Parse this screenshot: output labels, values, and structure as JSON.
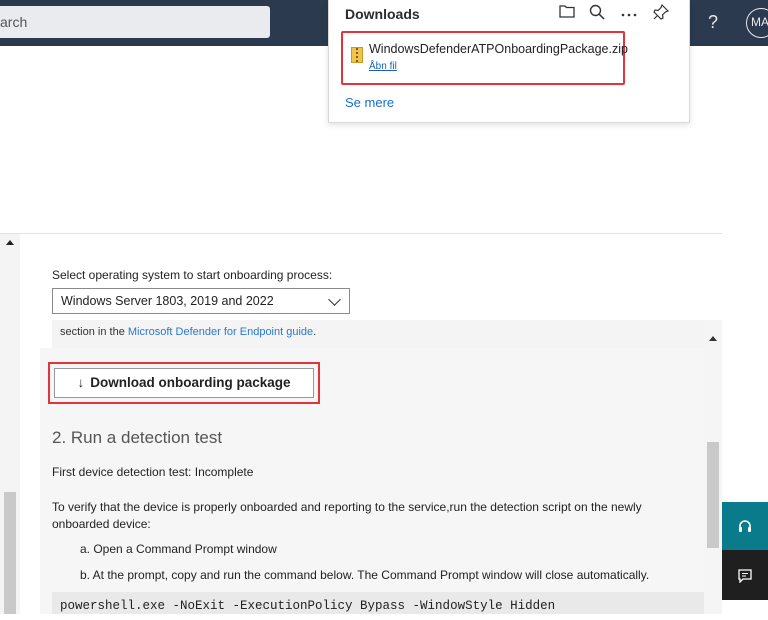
{
  "header": {
    "search_placeholder": "arch",
    "help": "?",
    "avatar": "MA"
  },
  "downloads": {
    "title": "Downloads",
    "icons": [
      "folder-icon",
      "search-icon",
      "more-icon",
      "pin-icon"
    ],
    "item": {
      "file_name": "WindowsDefenderATPOnboardingPackage.zip",
      "open_label": "Åbn fil"
    },
    "see_more": "Se mere"
  },
  "onboarding": {
    "os_label": "Select operating system to start onboarding process:",
    "os_selected": "Windows Server 1803, 2019 and 2022",
    "section_prefix": "section in the ",
    "section_link": "Microsoft Defender for Endpoint guide",
    "section_suffix": ".",
    "download_button": "Download onboarding package",
    "step2_title": "2. Run a detection test",
    "detection_status": "First device detection test: Incomplete",
    "verify_text": "To verify that the device is properly onboarded and reporting to the service,run the detection script on the newly onboarded device:",
    "step_a": "a. Open a Command Prompt window",
    "step_b": "b. At the prompt, copy and run the command below. The Command Prompt window will close automatically.",
    "command": "powershell.exe -NoExit -ExecutionPolicy Bypass -WindowStyle Hidden"
  }
}
